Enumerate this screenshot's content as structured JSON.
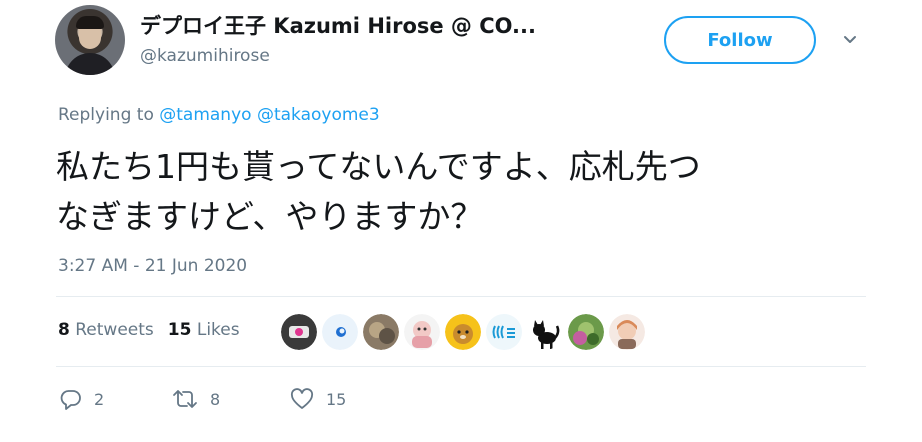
{
  "author": {
    "display_name": "デプロイ王子 Kazumi Hirose @ CO...",
    "handle": "@kazumihirose"
  },
  "follow_label": "Follow",
  "reply_context": {
    "prefix": "Replying to ",
    "mentions": [
      "@tamanyo",
      "@takaoyome3"
    ]
  },
  "tweet": {
    "line1": "私たち1円も貰ってないんですよ、応札先つ",
    "line2": "なぎますけど、やりますか？",
    "timestamp": "3:27 AM - 21 Jun 2020"
  },
  "stats": {
    "retweets_count": "8",
    "retweets_label": "Retweets",
    "likes_count": "15",
    "likes_label": "Likes"
  },
  "likers": [
    "liker-1",
    "liker-2",
    "liker-3",
    "liker-4",
    "liker-5",
    "liker-6",
    "liker-7",
    "liker-8",
    "liker-9"
  ],
  "actions": {
    "reply_count": "2",
    "retweet_count": "8",
    "like_count": "15"
  },
  "colors": {
    "accent": "#1da1f2",
    "muted": "#657786",
    "text": "#14171a"
  }
}
